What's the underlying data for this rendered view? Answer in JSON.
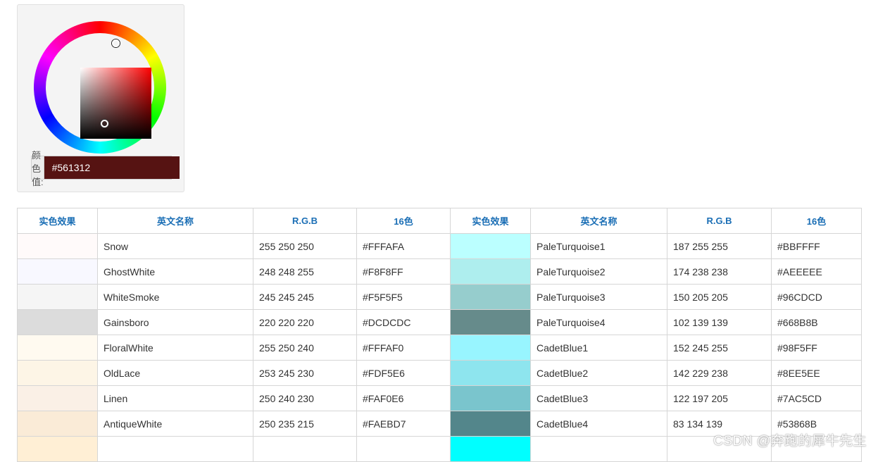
{
  "picker": {
    "label": "颜色值:",
    "value": "#561312",
    "hue_color": "#ff0000"
  },
  "table": {
    "headers": [
      "实色效果",
      "英文名称",
      "R.G.B",
      "16色",
      "实色效果",
      "英文名称",
      "R.G.B",
      "16色"
    ],
    "rows": [
      [
        {
          "swatch": "#FFFAFA",
          "name": "Snow",
          "rgb": "255 250 250",
          "hex": "#FFFAFA"
        },
        {
          "swatch": "#BBFFFF",
          "name": "PaleTurquoise1",
          "rgb": "187 255 255",
          "hex": "#BBFFFF"
        }
      ],
      [
        {
          "swatch": "#F8F8FF",
          "name": "GhostWhite",
          "rgb": "248 248 255",
          "hex": "#F8F8FF"
        },
        {
          "swatch": "#AEEEEE",
          "name": "PaleTurquoise2",
          "rgb": "174 238 238",
          "hex": "#AEEEEE"
        }
      ],
      [
        {
          "swatch": "#F5F5F5",
          "name": "WhiteSmoke",
          "rgb": "245 245 245",
          "hex": "#F5F5F5"
        },
        {
          "swatch": "#96CDCD",
          "name": "PaleTurquoise3",
          "rgb": "150 205 205",
          "hex": "#96CDCD"
        }
      ],
      [
        {
          "swatch": "#DCDCDC",
          "name": "Gainsboro",
          "rgb": "220 220 220",
          "hex": "#DCDCDC"
        },
        {
          "swatch": "#668B8B",
          "name": "PaleTurquoise4",
          "rgb": "102 139 139",
          "hex": "#668B8B"
        }
      ],
      [
        {
          "swatch": "#FFFAF0",
          "name": "FloralWhite",
          "rgb": "255 250 240",
          "hex": "#FFFAF0"
        },
        {
          "swatch": "#98F5FF",
          "name": "CadetBlue1",
          "rgb": "152 245 255",
          "hex": "#98F5FF"
        }
      ],
      [
        {
          "swatch": "#FDF5E6",
          "name": "OldLace",
          "rgb": "253 245 230",
          "hex": "#FDF5E6"
        },
        {
          "swatch": "#8EE5EE",
          "name": "CadetBlue2",
          "rgb": "142 229 238",
          "hex": "#8EE5EE"
        }
      ],
      [
        {
          "swatch": "#FAF0E6",
          "name": "Linen",
          "rgb": "250 240 230",
          "hex": "#FAF0E6"
        },
        {
          "swatch": "#7AC5CD",
          "name": "CadetBlue3",
          "rgb": "122 197 205",
          "hex": "#7AC5CD"
        }
      ],
      [
        {
          "swatch": "#FAEBD7",
          "name": "AntiqueWhite",
          "rgb": "250 235 215",
          "hex": "#FAEBD7"
        },
        {
          "swatch": "#53868B",
          "name": "CadetBlue4",
          "rgb": "83 134 139",
          "hex": "#53868B"
        }
      ],
      [
        {
          "swatch": "#FFEFD5",
          "name": "",
          "rgb": "",
          "hex": ""
        },
        {
          "swatch": "#00FFFF",
          "name": "",
          "rgb": "",
          "hex": ""
        }
      ]
    ]
  },
  "watermark": "CSDN @奔跑的犀牛先生"
}
